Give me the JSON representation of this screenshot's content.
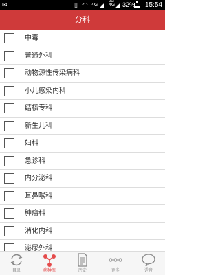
{
  "status_bar": {
    "network": "4G",
    "network2": "4G",
    "sim": "2G",
    "battery": "32%",
    "battery_level": 0.32,
    "time": "15:54"
  },
  "header": {
    "title": "分科"
  },
  "departments": [
    {
      "label": "中毒",
      "checked": false
    },
    {
      "label": "普通外科",
      "checked": false
    },
    {
      "label": "动物源性传染病科",
      "checked": false
    },
    {
      "label": "小儿感染内科",
      "checked": false
    },
    {
      "label": "结核专科",
      "checked": false
    },
    {
      "label": "新生儿科",
      "checked": false
    },
    {
      "label": "妇科",
      "checked": false
    },
    {
      "label": "急诊科",
      "checked": false
    },
    {
      "label": "内分泌科",
      "checked": false
    },
    {
      "label": "耳鼻喉科",
      "checked": false
    },
    {
      "label": "肿瘤科",
      "checked": false
    },
    {
      "label": "消化内科",
      "checked": false
    },
    {
      "label": "泌尿外科",
      "checked": false
    }
  ],
  "bottom_nav": [
    {
      "label": "目录",
      "icon": "refresh-icon",
      "active": false
    },
    {
      "label": "病种库",
      "icon": "share-nodes-icon",
      "active": true
    },
    {
      "label": "历史",
      "icon": "document-icon",
      "active": false
    },
    {
      "label": "更多",
      "icon": "more-dots-icon",
      "active": false
    },
    {
      "label": "语音",
      "icon": "chat-bubble-icon",
      "active": false
    }
  ],
  "colors": {
    "header_bg": "#cf3a3a",
    "active_tab": "#e44b4b",
    "inactive_tab": "#999999"
  }
}
